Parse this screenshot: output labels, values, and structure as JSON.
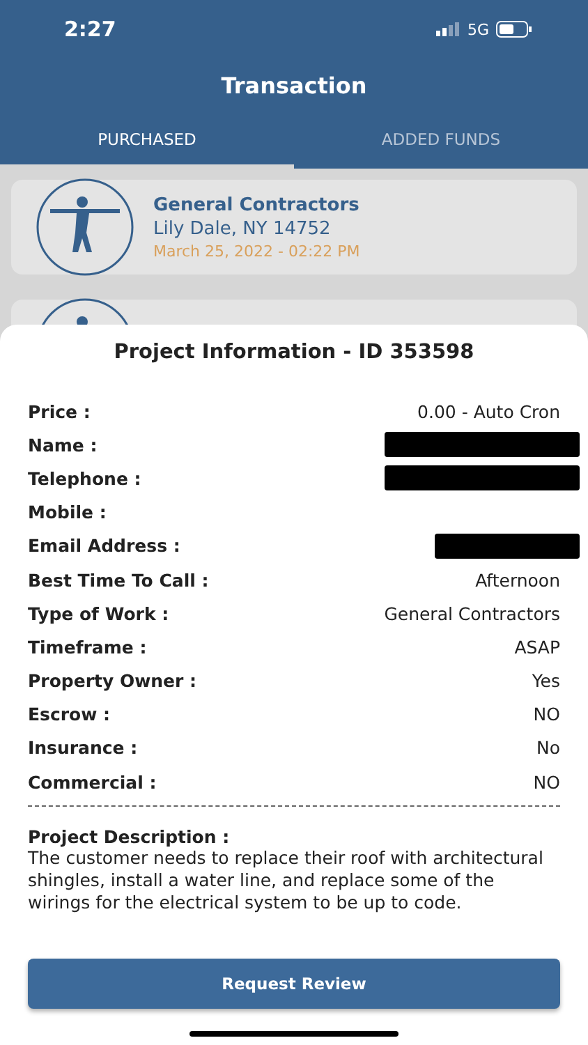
{
  "status_bar": {
    "time": "2:27",
    "network": "5G"
  },
  "header": {
    "title": "Transaction"
  },
  "tabs": [
    {
      "label": "PURCHASED",
      "selected": true
    },
    {
      "label": "ADDED FUNDS",
      "selected": false
    }
  ],
  "transactions": [
    {
      "title": "General Contractors",
      "location": "Lily Dale, NY 14752",
      "date": "March 25, 2022 - 02:22 PM"
    }
  ],
  "sheet": {
    "title": "Project Information - ID 353598",
    "fields": [
      {
        "label": "Price :",
        "kind": "text",
        "value": "0.00 - Auto Cron"
      },
      {
        "label": "Name :",
        "kind": "redacted"
      },
      {
        "label": "Telephone :",
        "kind": "redacted"
      },
      {
        "label": "Mobile :",
        "kind": "empty"
      },
      {
        "label": "Email Address :",
        "kind": "redacted"
      },
      {
        "label": "Best Time To Call :",
        "kind": "text",
        "value": "Afternoon"
      },
      {
        "label": "Type of Work :",
        "kind": "text",
        "value": "General Contractors"
      },
      {
        "label": "Timeframe :",
        "kind": "text",
        "value": "ASAP"
      },
      {
        "label": "Property Owner :",
        "kind": "text",
        "value": "Yes"
      },
      {
        "label": "Escrow :",
        "kind": "text",
        "value": "NO"
      },
      {
        "label": "Insurance :",
        "kind": "text",
        "value": "No"
      },
      {
        "label": "Commercial :",
        "kind": "text",
        "value": "NO"
      }
    ],
    "description_label": "Project Description :",
    "description": "The customer needs to replace their roof with architectural shingles, install a water line, and replace some of the wirings for the electrical system to be up to code.",
    "button": "Request Review"
  }
}
